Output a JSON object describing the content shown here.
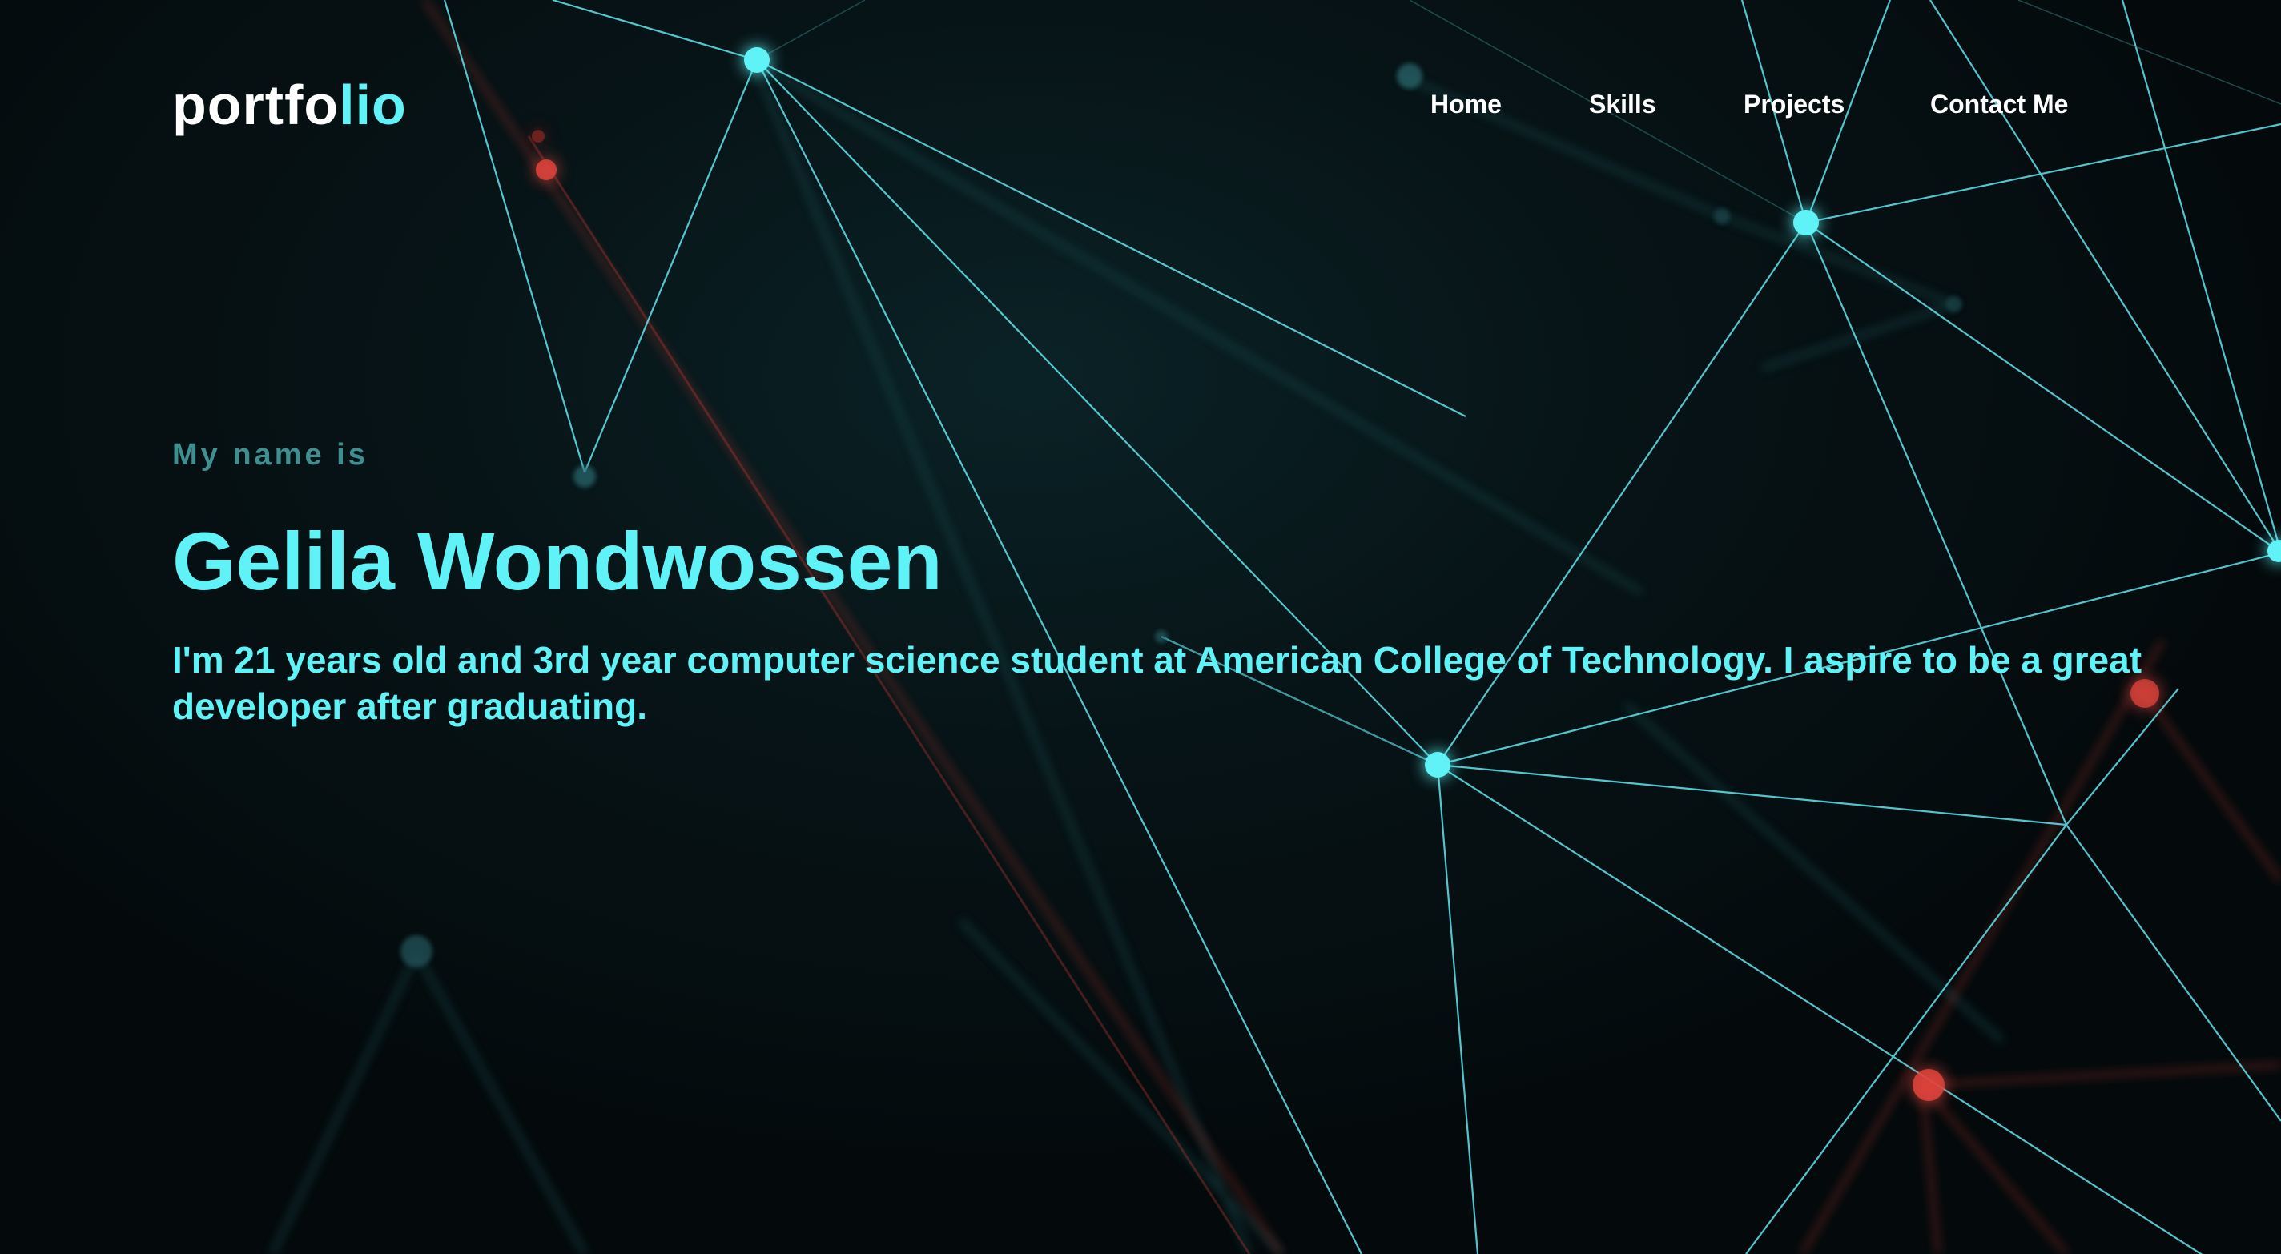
{
  "brand": {
    "logo_main": "portfo",
    "logo_accent": "lio"
  },
  "nav": {
    "items": [
      {
        "label": "Home"
      },
      {
        "label": "Skills"
      },
      {
        "label": "Projects"
      },
      {
        "label": "Contact Me"
      }
    ]
  },
  "hero": {
    "intro": "My name is",
    "name": "Gelila Wondwossen",
    "bio": "I'm 21 years old and 3rd year computer science student at American College of Technology. I aspire to be a great developer after graduating."
  },
  "colors": {
    "background": "#061112",
    "accent": "#5ff3f7",
    "intro_text": "#3f8e90",
    "nav_text": "#ffffff",
    "network_red": "#e0443c"
  }
}
